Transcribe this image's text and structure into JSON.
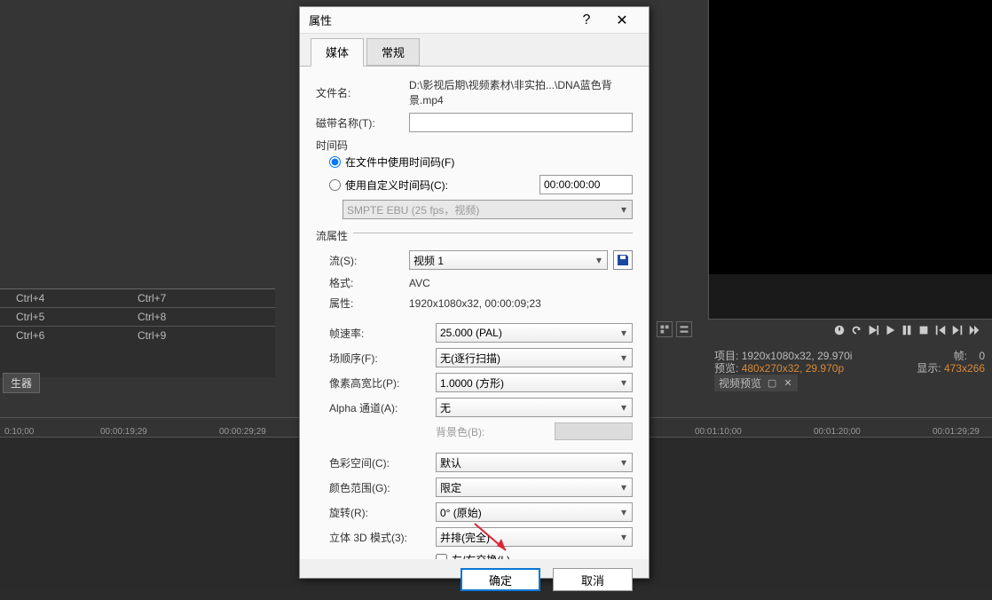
{
  "dialog": {
    "title": "属性",
    "tabs": {
      "media": "媒体",
      "general": "常规"
    },
    "fields": {
      "filename_label": "文件名:",
      "filename_value": "D:\\影视后期\\视频素材\\非实拍...\\DNA蓝色背景.mp4",
      "tapename_label": "磁带名称(T):",
      "tapename_value": "",
      "timecode_section": "时间码",
      "use_file_tc": "在文件中使用时间码(F)",
      "use_custom_tc": "使用自定义时间码(C):",
      "custom_tc_value": "00:00:00:00",
      "smpte_select": "SMPTE EBU (25 fps，视频)",
      "stream_section": "流属性",
      "stream_label": "流(S):",
      "stream_value": "视频 1",
      "format_label": "格式:",
      "format_value": "AVC",
      "props_label": "属性:",
      "props_value": "1920x1080x32, 00:00:09;23",
      "framerate_label": "帧速率:",
      "framerate_value": "25.000 (PAL)",
      "fieldorder_label": "场顺序(F):",
      "fieldorder_value": "无(逐行扫描)",
      "par_label": "像素高宽比(P):",
      "par_value": "1.0000 (方形)",
      "alpha_label": "Alpha 通道(A):",
      "alpha_value": "无",
      "bgcolor_label": "背景色(B):",
      "colorspace_label": "色彩空间(C):",
      "colorspace_value": "默认",
      "colorrange_label": "颜色范围(G):",
      "colorrange_value": "限定",
      "rotation_label": "旋转(R):",
      "rotation_value": "0° (原始)",
      "stereo3d_label": "立体 3D 模式(3):",
      "stereo3d_value": "并排(完全)",
      "swap_lr": "左/右交换(L)"
    },
    "buttons": {
      "ok": "确定",
      "cancel": "取消"
    }
  },
  "shortcuts": [
    [
      "Ctrl+4",
      "Ctrl+7"
    ],
    [
      "Ctrl+5",
      "Ctrl+8"
    ],
    [
      "Ctrl+6",
      "Ctrl+9"
    ]
  ],
  "gen_label": "生器",
  "timeline_ticks": [
    "0:10;00",
    "00:00:19;29",
    "00:00:29;29",
    "00:01:10;00",
    "00:01:20;00",
    "00:01:29;29"
  ],
  "info": {
    "project_label": "项目:",
    "project_value": "1920x1080x32, 29.970i",
    "preview_label": "预览:",
    "preview_value": "480x270x32, 29.970p",
    "frame_label": "帧:",
    "frame_value": "0",
    "display_label": "显示:",
    "display_value": "473x266",
    "video_preview": "视频预览"
  }
}
